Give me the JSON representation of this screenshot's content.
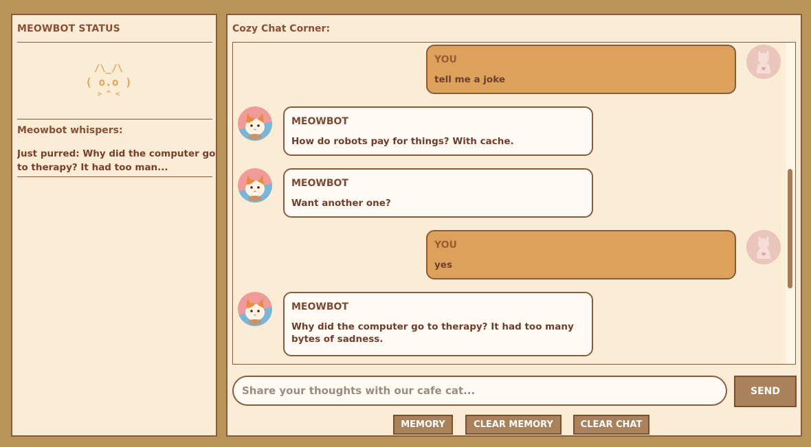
{
  "sidebar": {
    "status_title": "MEOWBOT STATUS",
    "cat_face": {
      "line1": "/\\_/\\",
      "line2": "( o.o )",
      "line3": "> ^ <"
    },
    "whispers_label": "Meowbot whispers:",
    "whisper_text": "Just purred: Why did the computer go to therapy? It had too man..."
  },
  "chat": {
    "title": "Cozy Chat Corner:",
    "messages": [
      {
        "role": "user",
        "sender": "YOU",
        "text": "tell me a joke"
      },
      {
        "role": "bot",
        "sender": "MEOWBOT",
        "text": "How do robots pay for things? With cache."
      },
      {
        "role": "bot",
        "sender": "MEOWBOT",
        "text": "Want another one?"
      },
      {
        "role": "user",
        "sender": "YOU",
        "text": "yes"
      },
      {
        "role": "bot",
        "sender": "MEOWBOT",
        "text": "Why did the computer go to therapy? It had too many bytes of sadness."
      }
    ],
    "scroll_position": 0.63
  },
  "input": {
    "placeholder": "Share your thoughts with our cafe cat...",
    "value": ""
  },
  "buttons": {
    "send": "SEND",
    "memory": "MEMORY",
    "clear_memory": "CLEAR MEMORY",
    "clear_chat": "CLEAR CHAT"
  },
  "icons": {
    "bot_avatar": "calico-cat-avatar-icon",
    "user_avatar": "cat-silhouette-avatar-icon"
  },
  "colors": {
    "frame": "#b8935a",
    "panel": "#fbecd6",
    "user_bubble": "#dca15b",
    "bot_bubble": "#fffaf3",
    "button": "#a9825c",
    "text": "#7a4a35"
  }
}
